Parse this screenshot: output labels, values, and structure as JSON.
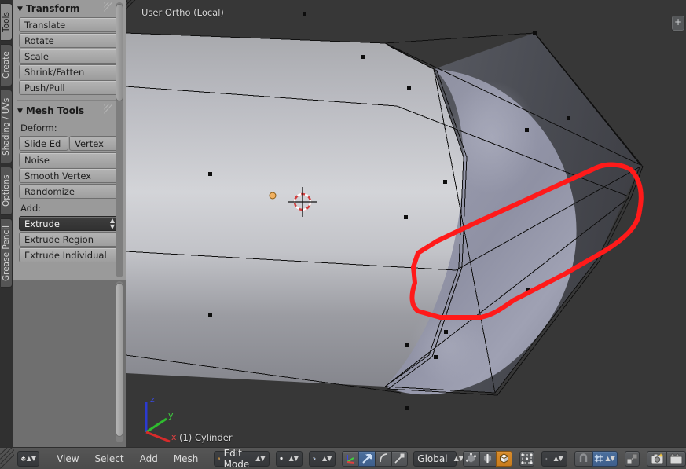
{
  "app": "Blender",
  "viewport": {
    "view_name": "User Ortho (Local)",
    "object_name": "(1) Cylinder",
    "background_color": "#373737",
    "annotation_color": "#ff1a1a",
    "axis_gizmo": {
      "z": "z",
      "y": "y",
      "x": "x",
      "z_color": "#2b3ad0",
      "y_color": "#2fbb2f",
      "x_color": "#d62b2b"
    },
    "n_panel_tab": "+"
  },
  "tool_shelf": {
    "tabs": [
      {
        "label": "Tools",
        "active": true
      },
      {
        "label": "Create",
        "active": false
      },
      {
        "label": "Shading / UVs",
        "active": false
      },
      {
        "label": "Options",
        "active": false
      },
      {
        "label": "Grease Pencil",
        "active": false
      }
    ],
    "panels": [
      {
        "title": "Transform",
        "collapsed": false,
        "buttons": [
          "Translate",
          "Rotate",
          "Scale",
          "Shrink/Fatten",
          "Push/Pull"
        ]
      },
      {
        "title": "Mesh Tools",
        "collapsed": false,
        "sections": [
          {
            "label": "Deform:",
            "pair": [
              "Slide Ed",
              "Vertex"
            ],
            "buttons": [
              "Noise",
              "Smooth Vertex",
              "Randomize"
            ]
          },
          {
            "label": "Add:",
            "dropdown": "Extrude",
            "buttons": [
              "Extrude Region",
              "Extrude Individual"
            ]
          }
        ]
      }
    ]
  },
  "header": {
    "editor_type_icon": "editor-3dview-icon",
    "menus": [
      "View",
      "Select",
      "Add",
      "Mesh"
    ],
    "mode": {
      "label": "Edit Mode",
      "icon": "edit-mode-icon"
    },
    "viewport_shading": {
      "icon": "solid-shading-icon"
    },
    "select_mode_dropdown": {
      "icon": "select-mode-icon"
    },
    "manipulator_buttons": [
      {
        "name": "manipulator-toggle",
        "icon": "axis-gizmo-icon",
        "active": false
      },
      {
        "name": "translate-manipulator",
        "icon": "translate-arrow-icon",
        "active": true
      },
      {
        "name": "rotate-manipulator",
        "icon": "rotate-arc-icon",
        "active": false
      },
      {
        "name": "scale-manipulator",
        "icon": "scale-handle-icon",
        "active": false
      }
    ],
    "transform_orientation": "Global",
    "mesh_select_modes": [
      {
        "name": "vertex-select-mode",
        "icon": "vertex-cube-icon",
        "active": false
      },
      {
        "name": "edge-select-mode",
        "icon": "edge-cube-icon",
        "active": false
      },
      {
        "name": "face-select-mode",
        "icon": "face-cube-icon",
        "active": true
      }
    ],
    "occlude_geometry": {
      "icon": "occlude-geometry-icon"
    },
    "pivot_point": {
      "icon": "pivot-median-icon"
    },
    "snap_magnet": {
      "icon": "snap-magnet-icon",
      "active": false
    },
    "snap_target": {
      "icon": "snap-increment-icon",
      "active": true
    },
    "proportional_edit": {
      "icon": "proportional-edit-icon"
    },
    "render_button": {
      "icon": "render-image-icon"
    },
    "animation_button": {
      "icon": "render-animation-icon"
    }
  }
}
